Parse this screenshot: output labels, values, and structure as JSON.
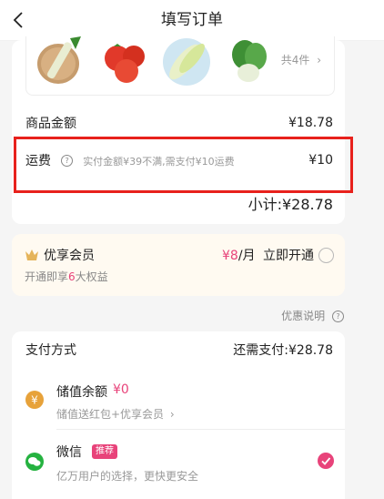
{
  "nav": {
    "title": "填写订单"
  },
  "order_items": {
    "count_text": "共4件"
  },
  "amount": {
    "goods_label": "商品金额",
    "goods_value": "¥18.78",
    "freight_label": "运费",
    "freight_note": "实付金额¥39不满,需支付¥10运费",
    "freight_value": "¥10",
    "subtotal_text": "小计:¥28.78"
  },
  "membership": {
    "title": "优享会员",
    "price_prefix": "¥",
    "price_value": "8",
    "price_unit": "/月",
    "action": "立即开通",
    "desc_prefix": "开通即享",
    "desc_number": "6",
    "desc_suffix": "大权益"
  },
  "discount_info": {
    "label": "优惠说明"
  },
  "payment": {
    "title": "支付方式",
    "due_text": "还需支付:¥28.78",
    "methods": [
      {
        "name": "储值余额",
        "balance": "¥0",
        "desc": "储值送红包+优享会员",
        "icon": "yen-coin-icon"
      },
      {
        "name": "微信",
        "badge": "推荐",
        "desc": "亿万用户的选择，更快更安全",
        "icon": "wechat-icon",
        "selected": true
      }
    ]
  },
  "colors": {
    "accent_pink": "#e8437a",
    "highlight_red": "#e8211c",
    "gold": "#e7a23a",
    "wechat_green": "#25b240"
  }
}
